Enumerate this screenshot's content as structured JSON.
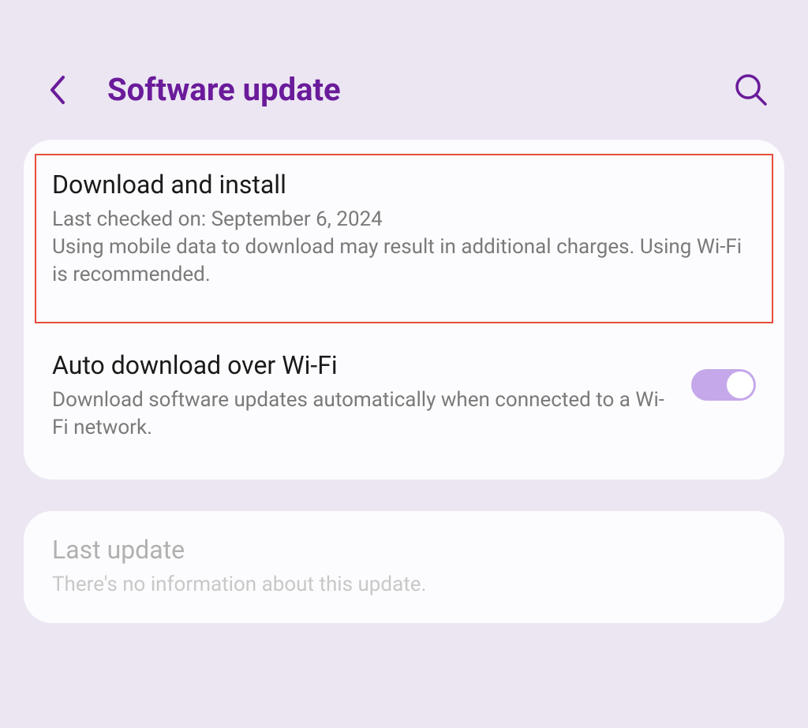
{
  "header": {
    "title": "Software update"
  },
  "card1": {
    "download": {
      "title": "Download and install",
      "lastChecked": "Last checked on: September 6, 2024",
      "warning": "Using mobile data to download may result in additional charges. Using Wi-Fi is recommended."
    },
    "autoDownload": {
      "title": "Auto download over Wi-Fi",
      "description": "Download software updates automatically when connected to a Wi-Fi network."
    }
  },
  "card2": {
    "lastUpdate": {
      "title": "Last update",
      "description": "There's no information about this update."
    }
  }
}
